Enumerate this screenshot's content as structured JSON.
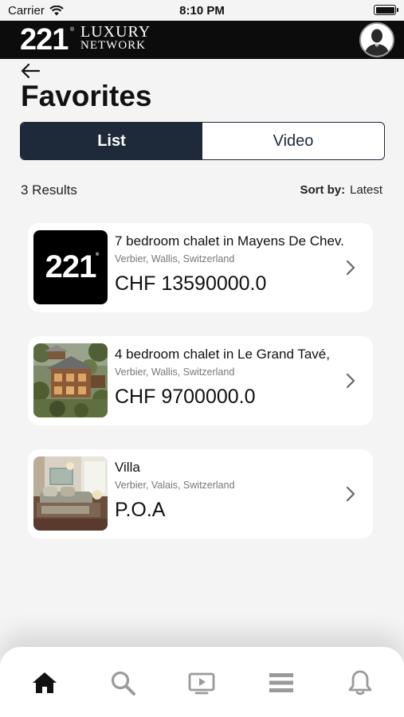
{
  "status_bar": {
    "carrier": "Carrier",
    "time": "8:10 PM"
  },
  "brand": {
    "number": "221",
    "reg_mark": "®",
    "line1": "LUXURY",
    "line2": "NETWORK"
  },
  "header": {
    "title": "Favorites"
  },
  "view_toggle": {
    "options": [
      "List",
      "Video"
    ],
    "selected": "List"
  },
  "results": {
    "count_text": "3 Results",
    "sort_label": "Sort by:",
    "sort_value": "Latest"
  },
  "listings": [
    {
      "title": "7 bedroom chalet in Mayens De Chev.",
      "location": "Verbier, Wallis, Switzerland",
      "price": "CHF 13590000.0",
      "thumb": "221-logo"
    },
    {
      "title": "4 bedroom chalet in Le Grand Tavé,",
      "location": "Verbier, Wallis, Switzerland",
      "price": "CHF 9700000.0",
      "thumb": "chalet-photo"
    },
    {
      "title": "Villa",
      "location": "Verbier, Valais, Switzerland",
      "price": "P.O.A",
      "thumb": "bedroom-photo"
    }
  ],
  "tab_bar": {
    "tabs": [
      "home-icon",
      "search-icon",
      "video-icon",
      "menu-icon",
      "bell-icon"
    ],
    "active": "home-icon"
  },
  "colors": {
    "accent": "#1e2a3a",
    "background": "#f4f4f5",
    "brand_bar": "#0c0c0c",
    "inactive_icon": "#9a9a9a"
  }
}
